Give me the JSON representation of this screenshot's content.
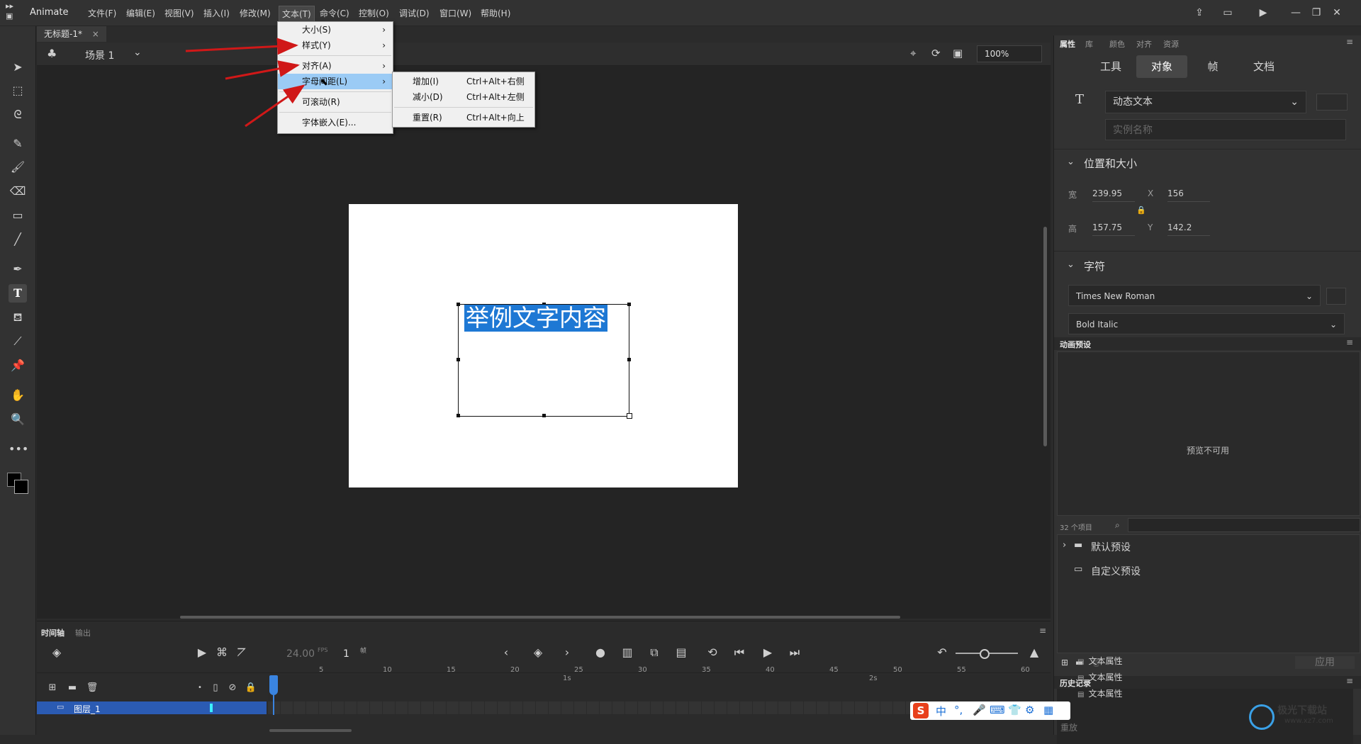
{
  "app": {
    "name": "Animate"
  },
  "menubar": {
    "items": [
      "文件(F)",
      "编辑(E)",
      "视图(V)",
      "插入(I)",
      "修改(M)",
      "文本(T)",
      "命令(C)",
      "控制(O)",
      "调试(D)",
      "窗口(W)",
      "帮助(H)"
    ]
  },
  "window_controls": {
    "minimize": "—",
    "restore": "❐",
    "close": "✕"
  },
  "document": {
    "tab_title": "无标题-1*",
    "tab_close": "×"
  },
  "scene": {
    "label": "场景 1",
    "zoom": "100%"
  },
  "text_menu": {
    "items": [
      {
        "label": "大小(S)",
        "arrow": "›"
      },
      {
        "label": "样式(Y)",
        "arrow": "›"
      },
      {
        "label": "对齐(A)",
        "arrow": "›"
      },
      {
        "label": "字母间距(L)",
        "arrow": "›"
      },
      {
        "label": "可滚动(R)",
        "arrow": ""
      },
      {
        "label": "字体嵌入(E)...",
        "arrow": ""
      }
    ]
  },
  "spacing_submenu": {
    "items": [
      {
        "label": "增加(I)",
        "shortcut": "Ctrl+Alt+右侧"
      },
      {
        "label": "减小(D)",
        "shortcut": "Ctrl+Alt+左侧"
      },
      {
        "label": "重置(R)",
        "shortcut": "Ctrl+Alt+向上"
      }
    ]
  },
  "stage_text": "举例文字内容",
  "right_panel": {
    "tabs": [
      "属性",
      "库",
      "颜色",
      "对齐",
      "资源"
    ],
    "segments": [
      "工具",
      "对象",
      "帧",
      "文档"
    ],
    "text_type": "动态文本",
    "instance_placeholder": "实例名称",
    "pos_size": {
      "title": "位置和大小",
      "w_label": "宽",
      "w": "239.95",
      "h_label": "高",
      "h": "157.75",
      "x_label": "X",
      "x": "156",
      "y_label": "Y",
      "y": "142.2"
    },
    "character": {
      "title": "字符",
      "font": "Times New Roman",
      "style": "Bold Italic"
    }
  },
  "motion_presets": {
    "title": "动画预设",
    "preview": "预览不可用",
    "count": "32 个项目",
    "folders": [
      "默认预设",
      "自定义预设"
    ],
    "apply": "应用"
  },
  "history": {
    "title": "历史记录",
    "items": [
      "文本属性",
      "文本属性",
      "文本属性"
    ],
    "replay": "重放"
  },
  "timeline": {
    "tabs": [
      "时间轴",
      "输出"
    ],
    "fps": "24.00",
    "fps_unit": "FPS",
    "frame": "1",
    "frame_unit": "帧",
    "layer_name": "图层_1",
    "ruler": [
      "5",
      "10",
      "15",
      "20",
      "25",
      "30",
      "35",
      "40",
      "45",
      "50",
      "55",
      "60"
    ],
    "ruler_seconds": [
      "1s",
      "2s"
    ]
  },
  "ime": {
    "label": "中"
  },
  "watermark": {
    "text": "极光下载站",
    "url": "www.xz7.com"
  }
}
